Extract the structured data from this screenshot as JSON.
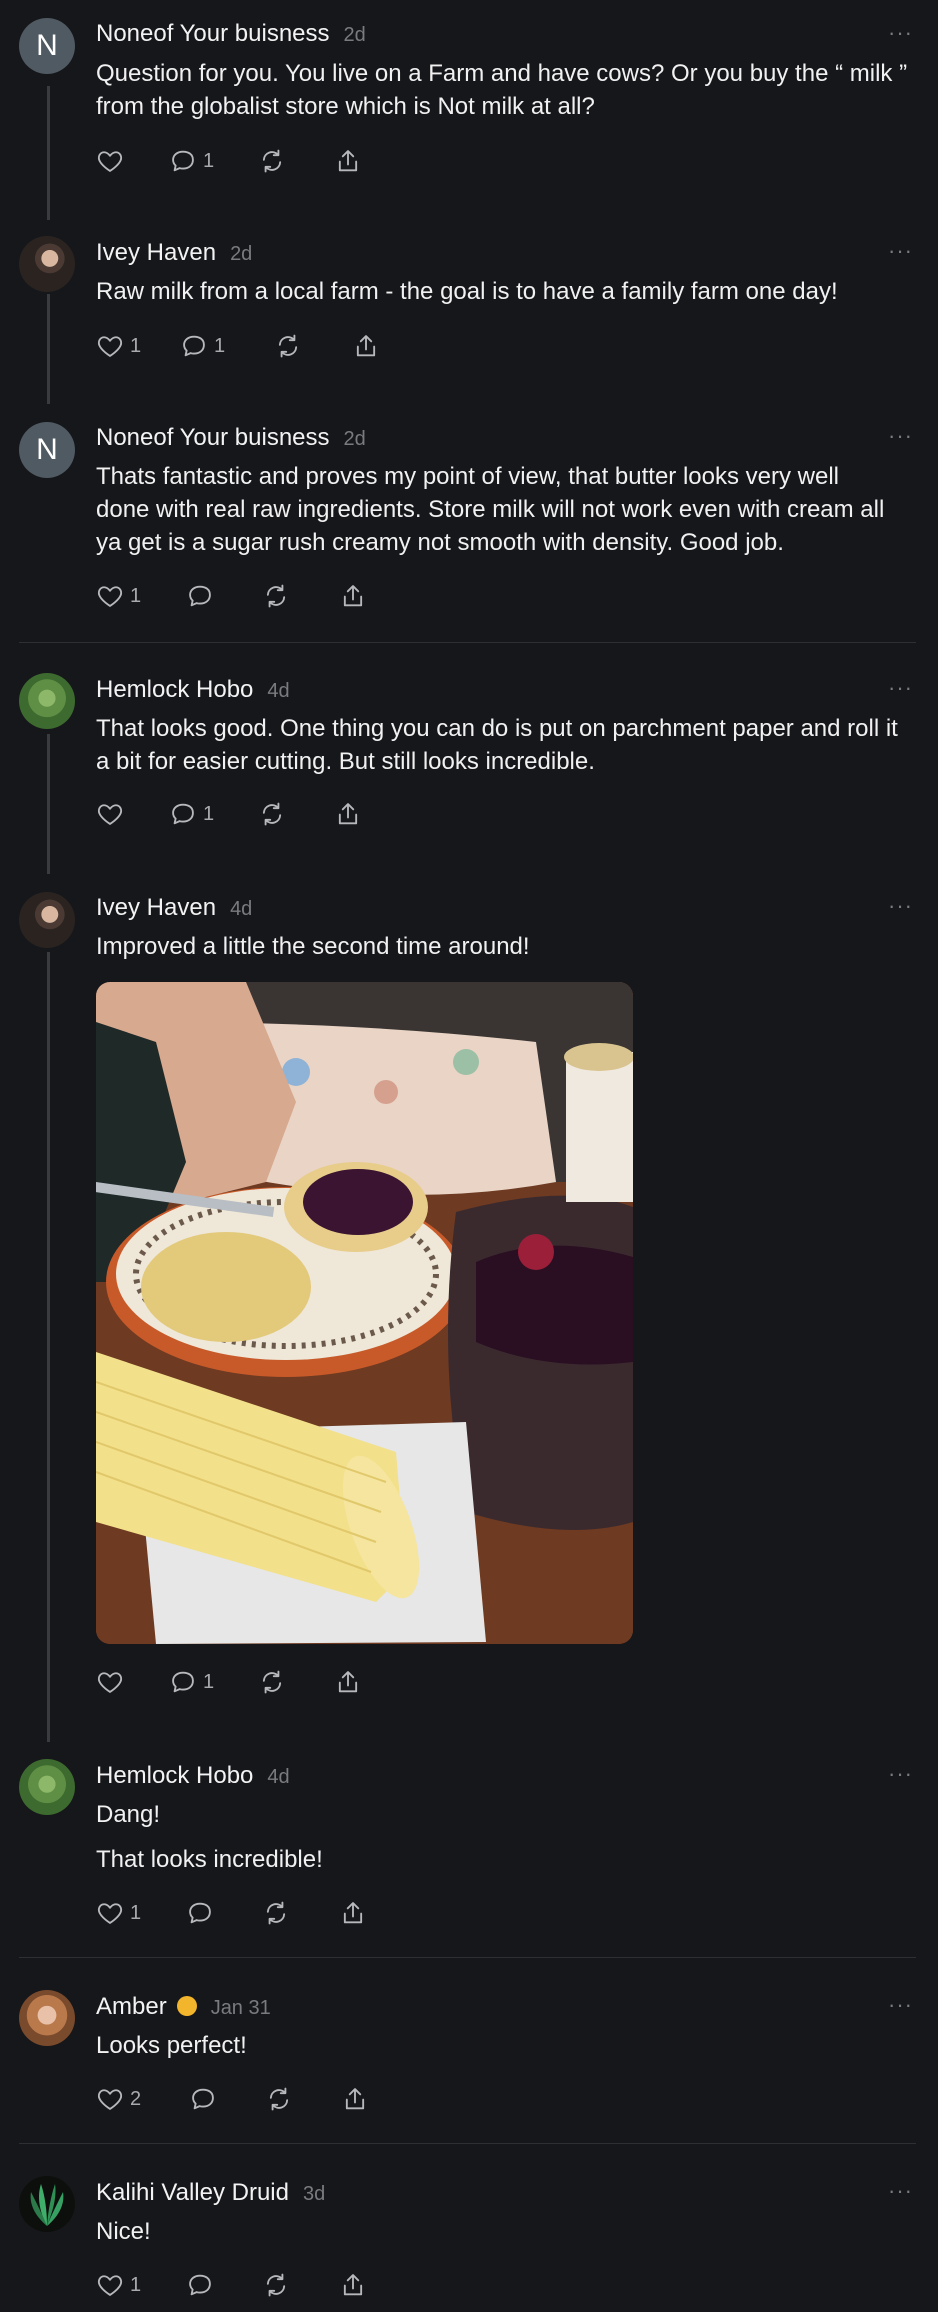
{
  "posts": [
    {
      "author": "Noneof Your buisness",
      "time": "2d",
      "avatar_letter": "N",
      "lines": [
        "Question for you. You live on a Farm and have cows? Or you buy the “ milk ”",
        "from the globalist store which is Not milk at all?"
      ],
      "likes": "",
      "replies": "1"
    },
    {
      "author": "Ivey Haven",
      "time": "2d",
      "lines": [
        "Raw milk from a local farm - the goal is to have a family farm one day!"
      ],
      "likes": "1",
      "replies": "1"
    },
    {
      "author": "Noneof Your buisness",
      "time": "2d",
      "avatar_letter": "N",
      "lines": [
        "Thats fantastic and proves my point of view, that butter looks very well",
        "done with real raw ingredients. Store milk will not work even with cream all",
        "ya get is a sugar rush creamy not smooth with density. Good job."
      ],
      "likes": "1",
      "replies": ""
    },
    {
      "author": "Hemlock Hobo",
      "time": "4d",
      "lines": [
        "That looks good. One thing you can do is put on parchment paper and roll it",
        "a bit for easier cutting. But still looks incredible."
      ],
      "likes": "",
      "replies": "1"
    },
    {
      "author": "Ivey Haven",
      "time": "4d",
      "lines": [
        "Improved a little the second time around!"
      ],
      "likes": "",
      "replies": "1"
    },
    {
      "author": "Hemlock Hobo",
      "time": "4d",
      "lines": [
        "Dang!",
        "That looks incredible!"
      ],
      "likes": "1",
      "replies": ""
    },
    {
      "author": "Amber",
      "time": "Jan 31",
      "lines": [
        "Looks perfect!"
      ],
      "likes": "2",
      "replies": ""
    },
    {
      "author": "Kalihi Valley Druid",
      "time": "3d",
      "lines": [
        "Nice!"
      ],
      "likes": "1",
      "replies": ""
    }
  ],
  "more_label": "···",
  "colors": {
    "background": "#16171a",
    "text": "#f1f1f2",
    "muted": "#7a7b80",
    "thread_line": "#3a3b3f"
  }
}
